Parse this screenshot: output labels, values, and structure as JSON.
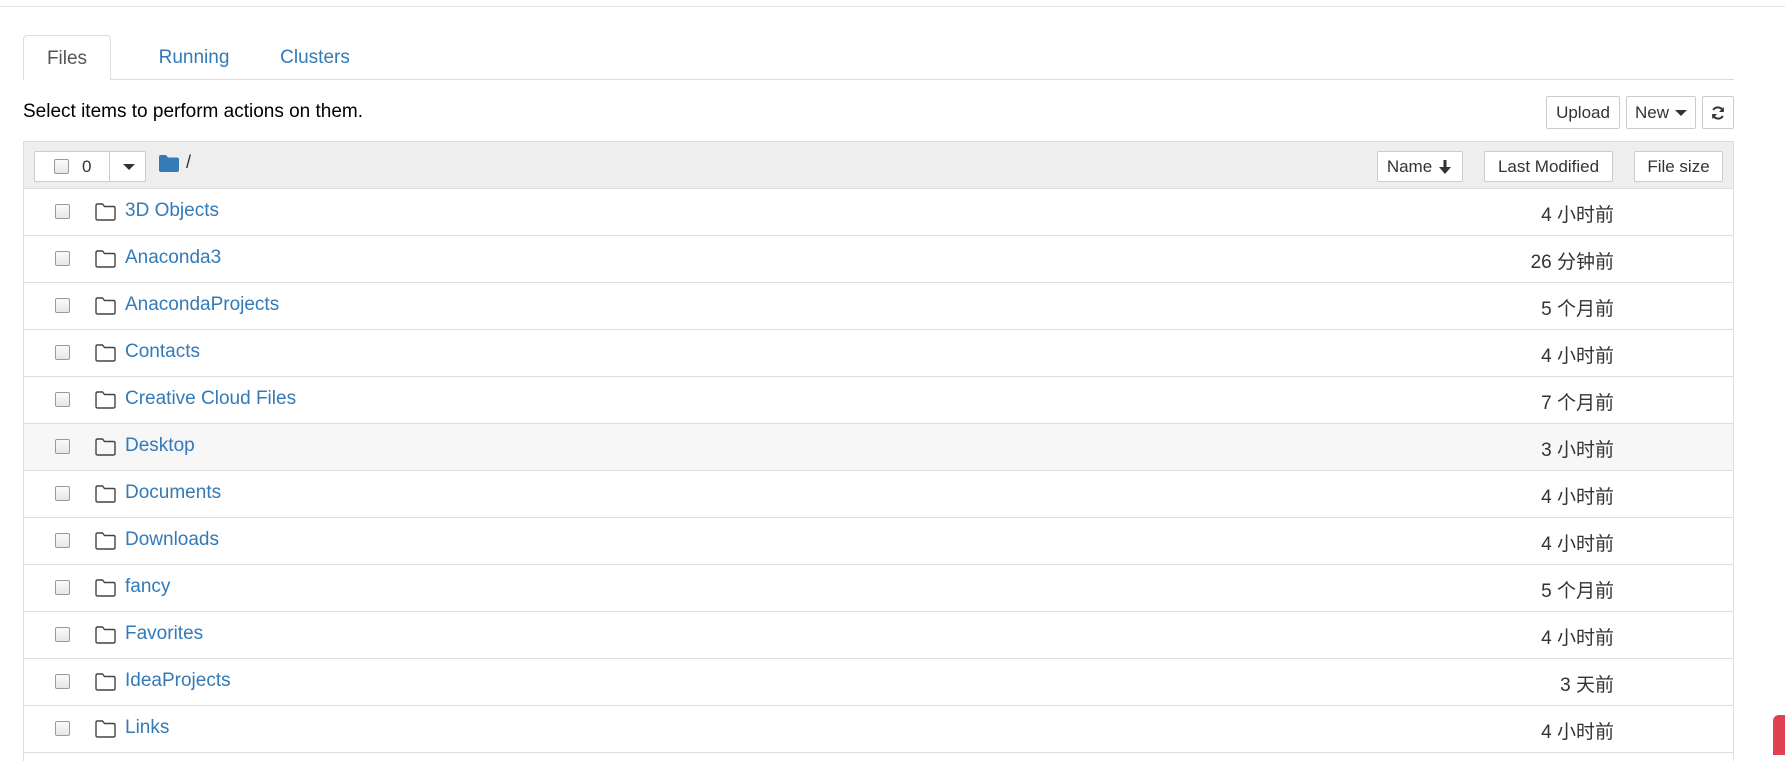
{
  "tabs": [
    {
      "label": "Files",
      "active": true
    },
    {
      "label": "Running",
      "active": false
    },
    {
      "label": "Clusters",
      "active": false
    }
  ],
  "toolbar": {
    "instructions": "Select items to perform actions on them.",
    "upload_label": "Upload",
    "new_label": "New"
  },
  "list_header": {
    "selected_count": "0",
    "breadcrumb": "/",
    "sort_name_label": "Name",
    "sort_modified_label": "Last Modified",
    "sort_size_label": "File size"
  },
  "files": [
    {
      "name": "3D Objects",
      "modified": "4 小时前"
    },
    {
      "name": "Anaconda3",
      "modified": "26 分钟前"
    },
    {
      "name": "AnacondaProjects",
      "modified": "5 个月前"
    },
    {
      "name": "Contacts",
      "modified": "4 小时前"
    },
    {
      "name": "Creative Cloud Files",
      "modified": "7 个月前"
    },
    {
      "name": "Desktop",
      "modified": "3 小时前"
    },
    {
      "name": "Documents",
      "modified": "4 小时前"
    },
    {
      "name": "Downloads",
      "modified": "4 小时前"
    },
    {
      "name": "fancy",
      "modified": "5 个月前"
    },
    {
      "name": "Favorites",
      "modified": "4 小时前"
    },
    {
      "name": "IdeaProjects",
      "modified": "3 天前"
    },
    {
      "name": "Links",
      "modified": "4 小时前"
    }
  ],
  "colors": {
    "link": "#337ab7",
    "header_bg": "#eeeeee",
    "border": "#dddddd",
    "icon": "#337ab7"
  }
}
